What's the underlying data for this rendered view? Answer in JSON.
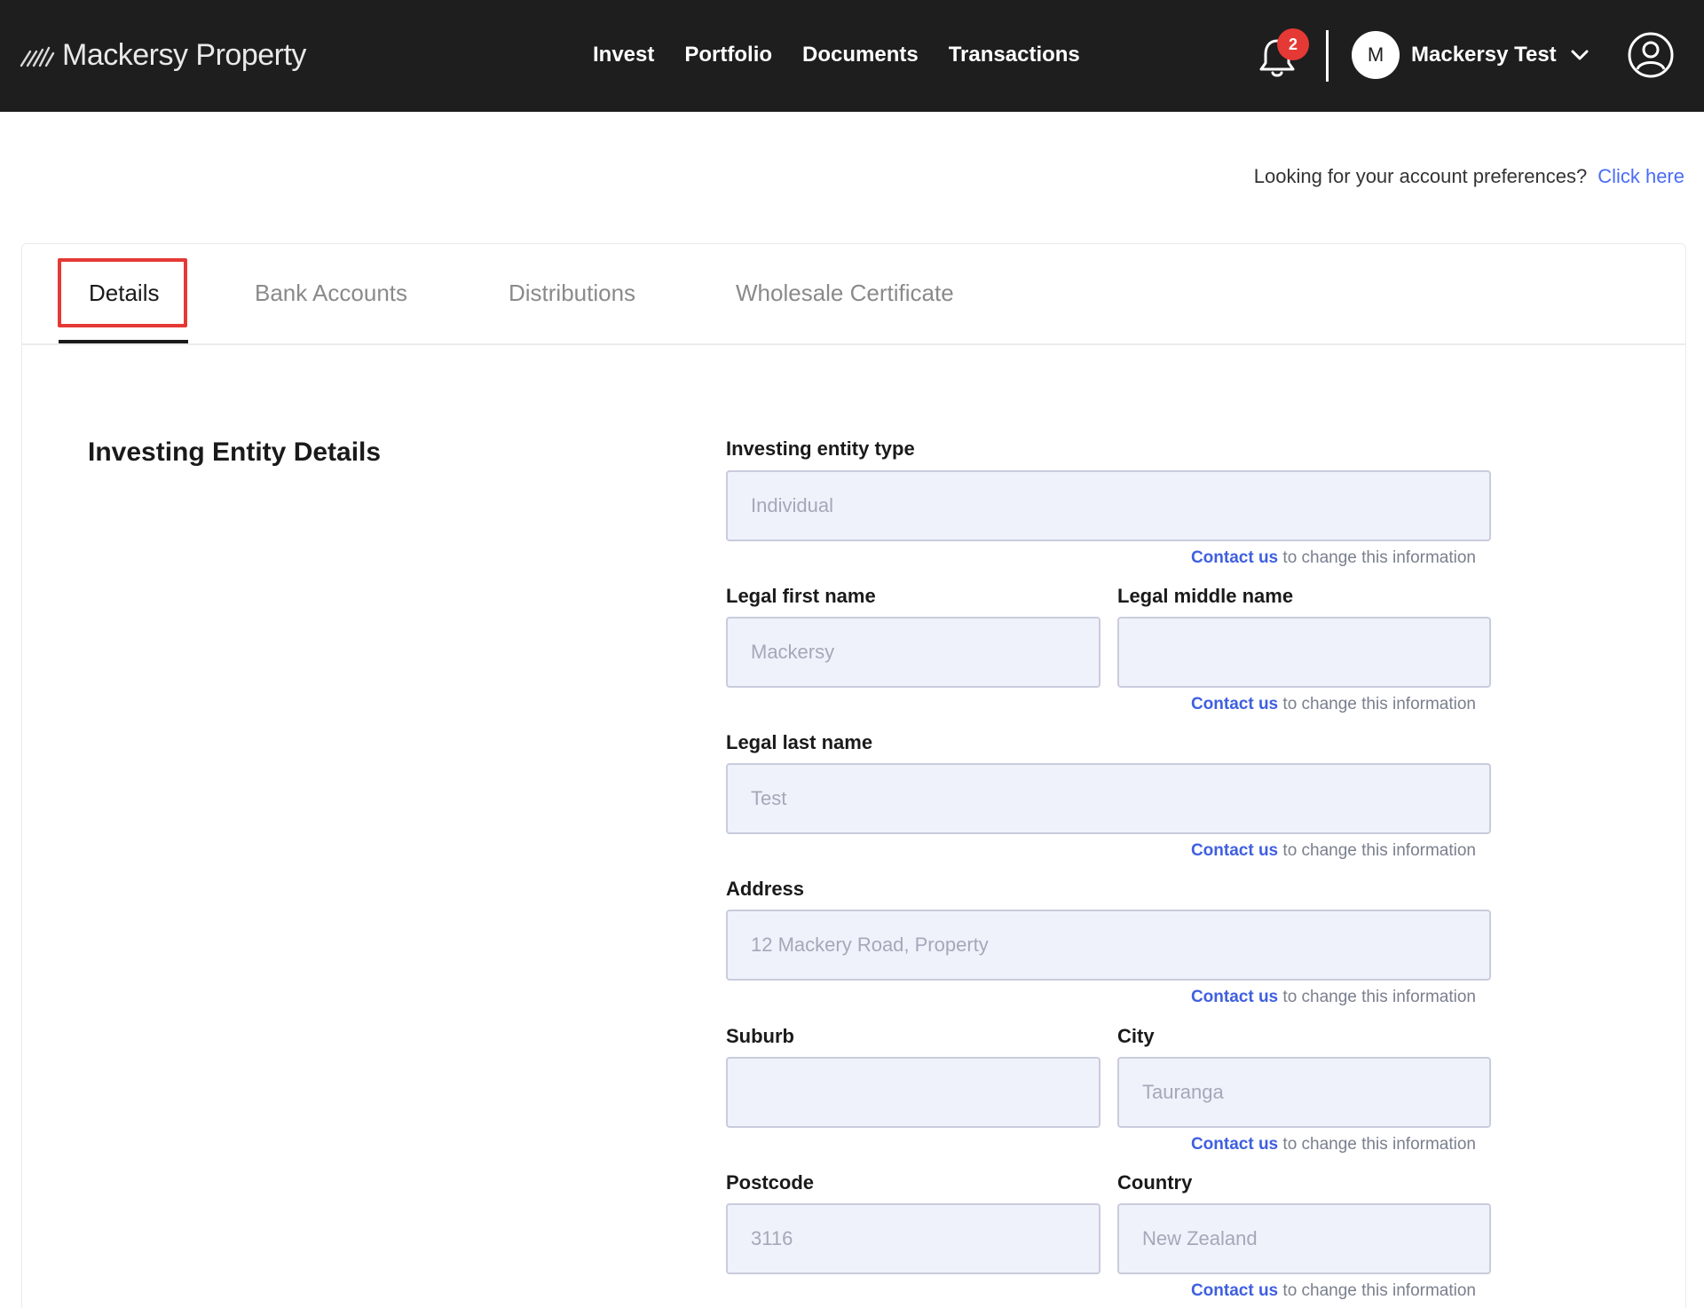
{
  "brand": {
    "name": "Mackersy Property"
  },
  "nav": {
    "items": [
      {
        "label": "Invest"
      },
      {
        "label": "Portfolio"
      },
      {
        "label": "Documents"
      },
      {
        "label": "Transactions"
      }
    ]
  },
  "notifications": {
    "count": "2"
  },
  "user": {
    "initial": "M",
    "name": "Mackersy Test"
  },
  "preferences": {
    "text": "Looking for your account preferences?",
    "link": "Click here"
  },
  "tabs": [
    {
      "label": "Details"
    },
    {
      "label": "Bank Accounts"
    },
    {
      "label": "Distributions"
    },
    {
      "label": "Wholesale Certificate"
    }
  ],
  "section": {
    "title": "Investing Entity Details"
  },
  "help": {
    "link": "Contact us",
    "text": " to change this information"
  },
  "fields": {
    "entity_type": {
      "label": "Investing entity type",
      "value": "Individual"
    },
    "first_name": {
      "label": "Legal first name",
      "value": "Mackersy"
    },
    "middle_name": {
      "label": "Legal middle name",
      "value": ""
    },
    "last_name": {
      "label": "Legal last name",
      "value": "Test"
    },
    "address": {
      "label": "Address",
      "value": "12 Mackery Road, Property"
    },
    "suburb": {
      "label": "Suburb",
      "value": ""
    },
    "city": {
      "label": "City",
      "value": "Tauranga"
    },
    "postcode": {
      "label": "Postcode",
      "value": "3116"
    },
    "country": {
      "label": "Country",
      "value": "New Zealand"
    }
  },
  "colors": {
    "topbar": "#1e1e1e",
    "accent": "#4a6cf7",
    "highlight": "#e53935",
    "field_bg": "#f0f2fb"
  }
}
